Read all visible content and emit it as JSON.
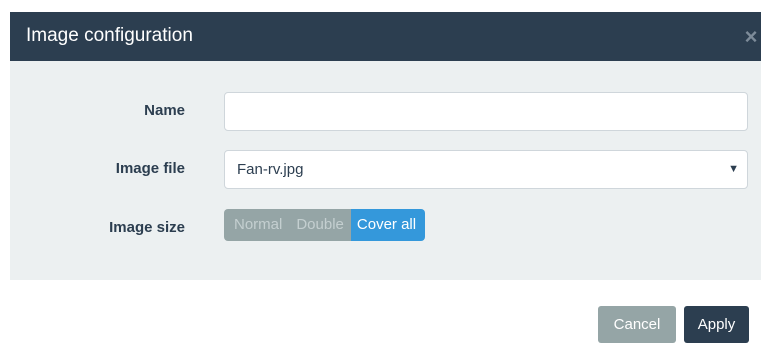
{
  "dialog": {
    "title": "Image configuration",
    "close_glyph": "×",
    "close_icon": "close-icon"
  },
  "form": {
    "name": {
      "label": "Name",
      "value": "",
      "placeholder": ""
    },
    "image_file": {
      "label": "Image file",
      "selected": "Fan-rv.jpg",
      "caret_glyph": "▼",
      "caret_icon": "chevron-down-icon"
    },
    "image_size": {
      "label": "Image size",
      "options": [
        "Normal",
        "Double",
        "Cover all"
      ],
      "selected": "Cover all"
    }
  },
  "footer": {
    "cancel_label": "Cancel",
    "apply_label": "Apply"
  },
  "colors": {
    "header_bg": "#2c3e50",
    "body_bg": "#ecf0f1",
    "accent": "#3498db",
    "muted": "#95a5a6"
  }
}
